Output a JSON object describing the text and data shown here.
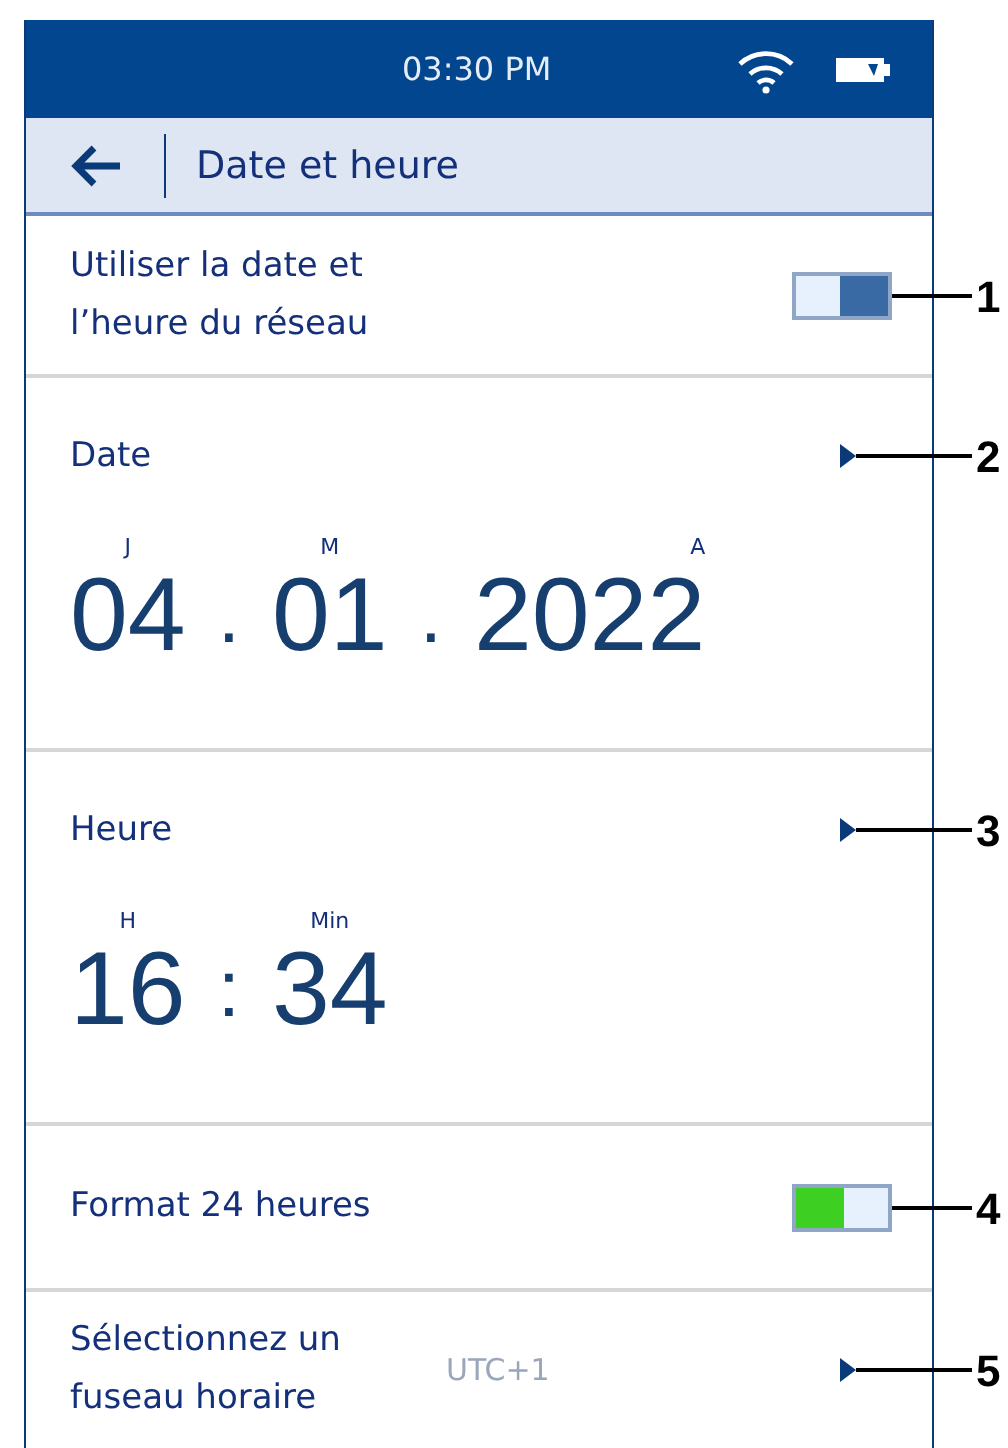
{
  "status_bar": {
    "time": "03:30 PM"
  },
  "header": {
    "title": "Date et heure"
  },
  "network_time": {
    "label": "Utiliser la date et l’heure du réseau",
    "on": false
  },
  "date": {
    "label": "Date",
    "fields": [
      {
        "unit": "J",
        "value": "04"
      },
      {
        "unit": "M",
        "value": "01"
      },
      {
        "unit": "A",
        "value": "2022"
      }
    ],
    "separator": "."
  },
  "time": {
    "label": "Heure",
    "fields": [
      {
        "unit": "H",
        "value": "16"
      },
      {
        "unit": "Min",
        "value": "34"
      }
    ],
    "separator": ":"
  },
  "format_24h": {
    "label": "Format 24 heures",
    "on": true
  },
  "timezone": {
    "label": "Sélectionnez un fuseau horaire",
    "value": "UTC+1"
  },
  "callouts": [
    "1",
    "2",
    "3",
    "4",
    "5"
  ]
}
